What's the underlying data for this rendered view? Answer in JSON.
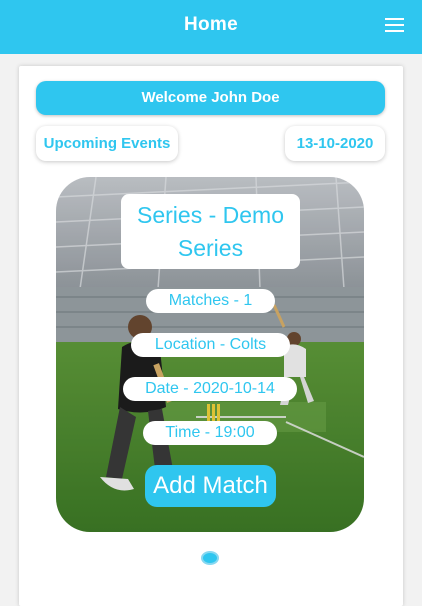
{
  "appbar": {
    "title": "Home",
    "menu_icon": "hamburger-menu-icon",
    "color": "#2fc6ef"
  },
  "welcome": {
    "text": "Welcome John Doe"
  },
  "events_header": {
    "label": "Upcoming Events",
    "date": "13-10-2020"
  },
  "event": {
    "series": "Series - Demo Series",
    "matches": "Matches - 1",
    "location": "Location - Colts",
    "date": "Date - 2020-10-14",
    "time": "Time - 19:00",
    "add_match_label": "Add Match"
  },
  "carousel": {
    "pages": 1,
    "active": 1
  },
  "colors": {
    "accent": "#2fc6ef",
    "background": "#f2f2f2"
  }
}
